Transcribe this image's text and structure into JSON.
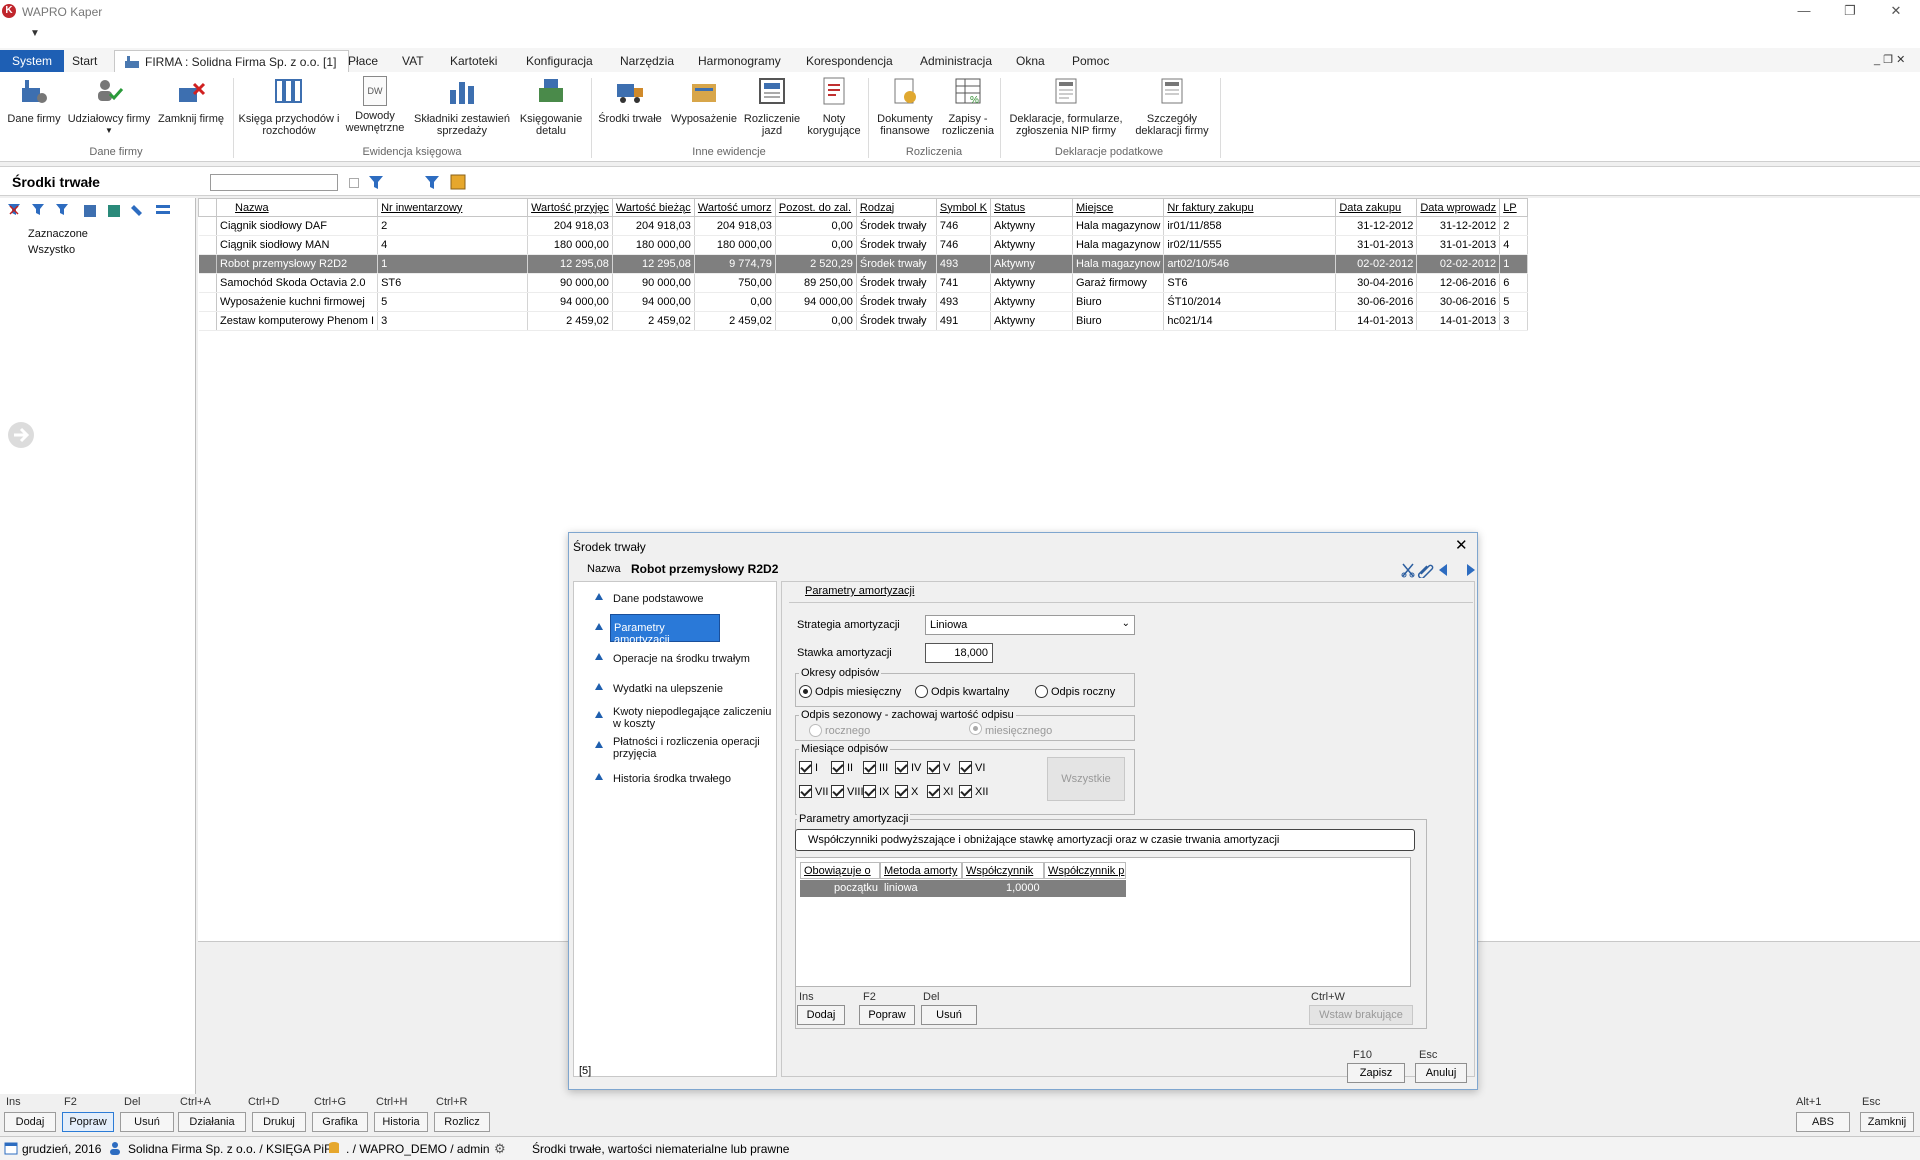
{
  "window": {
    "title": "WAPRO Kaper",
    "logo_letter": "K",
    "btn_minimize": "—",
    "btn_restore": "❐",
    "btn_close": "✕"
  },
  "quickbar": {
    "dropdown": "▼"
  },
  "menu": {
    "tabs": [
      "System",
      "Start",
      "FIRMA : Solidna Firma Sp. z o.o. [1]",
      "Płace",
      "VAT",
      "Kartoteki",
      "Konfiguracja",
      "Narzędzia",
      "Harmonogramy",
      "Korespondencja",
      "Administracja",
      "Okna",
      "Pomoc"
    ],
    "right_controls": "_ ❐ ✕"
  },
  "ribbon": {
    "groups": [
      {
        "label": "Dane firmy",
        "buttons": [
          "Dane firmy",
          "Udziałowcy firmy",
          "Zamknij firmę"
        ]
      },
      {
        "label": "Ewidencja księgowa",
        "buttons": [
          "Księga przychodów i rozchodów",
          "Dowody wewnętrzne",
          "Składniki zestawień sprzedaży",
          "Księgowanie detalu"
        ]
      },
      {
        "label": "Inne ewidencje",
        "buttons": [
          "Środki trwałe",
          "Wyposażenie",
          "Rozliczenie jazd",
          "Noty korygujące"
        ]
      },
      {
        "label": "Rozliczenia",
        "buttons": [
          "Dokumenty finansowe",
          "Zapisy - rozliczenia"
        ]
      },
      {
        "label": "Deklaracje podatkowe",
        "buttons": [
          "Deklaracje, formularze, zgłoszenia NIP firmy",
          "Szczegóły deklaracji firmy"
        ]
      }
    ],
    "dw_icon_text": "DW"
  },
  "section": {
    "title": "Środki trwałe",
    "search_value": ""
  },
  "tree": {
    "items": [
      "Zaznaczone",
      "Wszystko"
    ]
  },
  "grid": {
    "columns": [
      "Nazwa",
      "Nr inwentarzowy",
      "Wartość przyjęc",
      "Wartość bieżąc",
      "Wartość umorz",
      "Pozost. do zal.",
      "Rodzaj",
      "Symbol K",
      "Status",
      "Miejsce",
      "Nr faktury zakupu",
      "Data zakupu",
      "Data wprowadz",
      "LP"
    ],
    "rows": [
      [
        "Ciągnik siodłowy DAF",
        "2",
        "204 918,03",
        "204 918,03",
        "204 918,03",
        "0,00",
        "Środek trwały",
        "746",
        "Aktywny",
        "Hala magazynow",
        "ir01/11/858",
        "31-12-2012",
        "31-12-2012",
        "2"
      ],
      [
        "Ciągnik siodłowy MAN",
        "4",
        "180 000,00",
        "180 000,00",
        "180 000,00",
        "0,00",
        "Środek trwały",
        "746",
        "Aktywny",
        "Hala magazynow",
        "ir02/11/555",
        "31-01-2013",
        "31-01-2013",
        "4"
      ],
      [
        "Robot przemysłowy R2D2",
        "1",
        "12 295,08",
        "12 295,08",
        "9 774,79",
        "2 520,29",
        "Środek trwały",
        "493",
        "Aktywny",
        "Hala magazynow",
        "art02/10/546",
        "02-02-2012",
        "02-02-2012",
        "1"
      ],
      [
        "Samochód Skoda Octavia 2.0",
        "ST6",
        "90 000,00",
        "90 000,00",
        "750,00",
        "89 250,00",
        "Środek trwały",
        "741",
        "Aktywny",
        "Garaż firmowy",
        "ST6",
        "30-04-2016",
        "12-06-2016",
        "6"
      ],
      [
        "Wyposażenie kuchni firmowej",
        "5",
        "94 000,00",
        "94 000,00",
        "0,00",
        "94 000,00",
        "Środek trwały",
        "493",
        "Aktywny",
        "Biuro",
        "ŚT10/2014",
        "30-06-2016",
        "30-06-2016",
        "5"
      ],
      [
        "Zestaw komputerowy Phenom I",
        "3",
        "2 459,02",
        "2 459,02",
        "2 459,02",
        "0,00",
        "Środek trwały",
        "491",
        "Aktywny",
        "Biuro",
        "hc021/14",
        "14-01-2013",
        "14-01-2013",
        "3"
      ]
    ],
    "selected_row": 2
  },
  "bottom": {
    "buttons": [
      {
        "key": "Ins",
        "label": "Dodaj"
      },
      {
        "key": "F2",
        "label": "Popraw"
      },
      {
        "key": "Del",
        "label": "Usuń"
      },
      {
        "key": "Ctrl+A",
        "label": "Działania"
      },
      {
        "key": "Ctrl+D",
        "label": "Drukuj"
      },
      {
        "key": "Ctrl+G",
        "label": "Grafika"
      },
      {
        "key": "Ctrl+H",
        "label": "Historia"
      },
      {
        "key": "Ctrl+R",
        "label": "Rozlicz"
      }
    ],
    "right_buttons": [
      {
        "key": "Alt+1",
        "label": "ABS"
      },
      {
        "key": "Esc",
        "label": "Zamknij"
      }
    ]
  },
  "status": {
    "period": "grudzień, 2016",
    "company": "Solidna Firma Sp. z o.o. / KSIĘGA PiR",
    "db": ". / WAPRO_DEMO / admin",
    "module": "Środki trwałe, wartości niematerialne lub prawne"
  },
  "dialog": {
    "title": "Środek trwały",
    "close": "✕",
    "name_label": "Nazwa",
    "name_value": "Robot przemysłowy R2D2",
    "nav": [
      "Dane podstawowe",
      "Parametry amortyzacji",
      "Operacje na środku trwałym",
      "Wydatki na ulepszenie",
      "Kwoty niepodlegające zaliczeniu w koszty",
      "Płatności i rozliczenia operacji przyjęcia",
      "Historia środka trwałego"
    ],
    "active_nav": 1,
    "panel_tab": "Parametry amortyzacji",
    "strategy_label": "Strategia amortyzacji",
    "strategy_value": "Liniowa",
    "rate_label": "Stawka amortyzacji",
    "rate_value": "18,000",
    "periods_title": "Okresy odpisów",
    "periods": [
      "Odpis miesięczny",
      "Odpis kwartalny",
      "Odpis roczny"
    ],
    "seasonal_title": "Odpis sezonowy - zachowaj wartość odpisu",
    "seasonal": [
      "rocznego",
      "miesięcznego"
    ],
    "months_title": "Miesiące odpisów",
    "months": [
      "I",
      "II",
      "III",
      "IV",
      "V",
      "VI",
      "VII",
      "VIII",
      "IX",
      "X",
      "XI",
      "XII"
    ],
    "all_button": "Wszystkie",
    "params_title": "Parametry amortyzacji",
    "params_desc": "Współczynniki podwyższające i obniżające stawkę amortyzacji oraz w czasie trwania amortyzacji",
    "coef_columns": [
      "Obowiązuje o",
      "Metoda amorty",
      "Współczynnik",
      "Współczynnik p"
    ],
    "coef_row": [
      "początku",
      "liniowa",
      "1,0000",
      ""
    ],
    "coef_buttons": [
      {
        "key": "Ins",
        "label": "Dodaj"
      },
      {
        "key": "F2",
        "label": "Popraw"
      },
      {
        "key": "Del",
        "label": "Usuń"
      }
    ],
    "coef_right": {
      "key": "Ctrl+W",
      "label": "Wstaw brakujące"
    },
    "counter": "[5]",
    "save": {
      "key": "F10",
      "label": "Zapisz"
    },
    "cancel": {
      "key": "Esc",
      "label": "Anuluj"
    }
  },
  "colors": {
    "accent": "#1e5fb4",
    "selection": "#7f7f7f",
    "nav_active": "#2a79d8"
  }
}
